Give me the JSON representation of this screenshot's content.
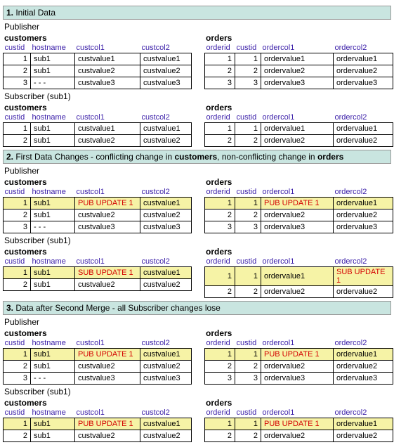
{
  "sections": [
    {
      "num": "1.",
      "title_plain": " Initial Data",
      "title_bold_parts": [],
      "blocks": [
        {
          "role": "Publisher",
          "customers": {
            "title": "customers",
            "headers": [
              "custid",
              "hostname",
              "custcol1",
              "custcol2"
            ],
            "rows": [
              {
                "cells": [
                  "1",
                  "sub1",
                  "custvalue1",
                  "custvalue1"
                ],
                "hl": false,
                "upd": []
              },
              {
                "cells": [
                  "2",
                  "sub1",
                  "custvalue2",
                  "custvalue2"
                ],
                "hl": false,
                "upd": []
              },
              {
                "cells": [
                  "3",
                  "- - -",
                  "custvalue3",
                  "custvalue3"
                ],
                "hl": false,
                "upd": []
              }
            ]
          },
          "orders": {
            "title": "orders",
            "headers": [
              "orderid",
              "custid",
              "ordercol1",
              "ordercol2"
            ],
            "rows": [
              {
                "cells": [
                  "1",
                  "1",
                  "ordervalue1",
                  "ordervalue1"
                ],
                "hl": false,
                "upd": []
              },
              {
                "cells": [
                  "2",
                  "2",
                  "ordervalue2",
                  "ordervalue2"
                ],
                "hl": false,
                "upd": []
              },
              {
                "cells": [
                  "3",
                  "3",
                  "ordervalue3",
                  "ordervalue3"
                ],
                "hl": false,
                "upd": []
              }
            ]
          }
        },
        {
          "role": "Subscriber (sub1)",
          "customers": {
            "title": "customers",
            "headers": [
              "custid",
              "hostname",
              "custcol1",
              "custcol2"
            ],
            "rows": [
              {
                "cells": [
                  "1",
                  "sub1",
                  "custvalue1",
                  "custvalue1"
                ],
                "hl": false,
                "upd": []
              },
              {
                "cells": [
                  "2",
                  "sub1",
                  "custvalue2",
                  "custvalue2"
                ],
                "hl": false,
                "upd": []
              }
            ]
          },
          "orders": {
            "title": "orders",
            "headers": [
              "orderid",
              "custid",
              "ordercol1",
              "ordercol2"
            ],
            "rows": [
              {
                "cells": [
                  "1",
                  "1",
                  "ordervalue1",
                  "ordervalue1"
                ],
                "hl": false,
                "upd": []
              },
              {
                "cells": [
                  "2",
                  "2",
                  "ordervalue2",
                  "ordervalue2"
                ],
                "hl": false,
                "upd": []
              }
            ]
          }
        }
      ]
    },
    {
      "num": "2.",
      "title_plain": " First Data Changes - conflicting change in ",
      "title_bold_parts": [
        "customers",
        ", non-conflicting change in ",
        "orders"
      ],
      "blocks": [
        {
          "role": "Publisher",
          "customers": {
            "title": "customers",
            "headers": [
              "custid",
              "hostname",
              "custcol1",
              "custcol2"
            ],
            "rows": [
              {
                "cells": [
                  "1",
                  "sub1",
                  "PUB UPDATE 1",
                  "custvalue1"
                ],
                "hl": true,
                "upd": [
                  2
                ]
              },
              {
                "cells": [
                  "2",
                  "sub1",
                  "custvalue2",
                  "custvalue2"
                ],
                "hl": false,
                "upd": []
              },
              {
                "cells": [
                  "3",
                  "- - -",
                  "custvalue3",
                  "custvalue3"
                ],
                "hl": false,
                "upd": []
              }
            ]
          },
          "orders": {
            "title": "orders",
            "headers": [
              "orderid",
              "custid",
              "ordercol1",
              "ordercol2"
            ],
            "rows": [
              {
                "cells": [
                  "1",
                  "1",
                  "PUB UPDATE 1",
                  "ordervalue1"
                ],
                "hl": true,
                "upd": [
                  2
                ]
              },
              {
                "cells": [
                  "2",
                  "2",
                  "ordervalue2",
                  "ordervalue2"
                ],
                "hl": false,
                "upd": []
              },
              {
                "cells": [
                  "3",
                  "3",
                  "ordervalue3",
                  "ordervalue3"
                ],
                "hl": false,
                "upd": []
              }
            ]
          }
        },
        {
          "role": "Subscriber (sub1)",
          "customers": {
            "title": "customers",
            "headers": [
              "custid",
              "hostname",
              "custcol1",
              "custcol2"
            ],
            "rows": [
              {
                "cells": [
                  "1",
                  "sub1",
                  "SUB UPDATE 1",
                  "custvalue1"
                ],
                "hl": true,
                "upd": [
                  2
                ]
              },
              {
                "cells": [
                  "2",
                  "sub1",
                  "custvalue2",
                  "custvalue2"
                ],
                "hl": false,
                "upd": []
              }
            ]
          },
          "orders": {
            "title": "orders",
            "headers": [
              "orderid",
              "custid",
              "ordercol1",
              "ordercol2"
            ],
            "rows": [
              {
                "cells": [
                  "1",
                  "1",
                  "ordervalue1",
                  "SUB UPDATE 1"
                ],
                "hl": true,
                "upd": [
                  3
                ]
              },
              {
                "cells": [
                  "2",
                  "2",
                  "ordervalue2",
                  "ordervalue2"
                ],
                "hl": false,
                "upd": []
              }
            ]
          }
        }
      ]
    },
    {
      "num": "3.",
      "title_plain": " Data after Second Merge - all Subscriber changes lose",
      "title_bold_parts": [],
      "blocks": [
        {
          "role": "Publisher",
          "customers": {
            "title": "customers",
            "headers": [
              "custid",
              "hostname",
              "custcol1",
              "custcol2"
            ],
            "rows": [
              {
                "cells": [
                  "1",
                  "sub1",
                  "PUB UPDATE 1",
                  "custvalue1"
                ],
                "hl": true,
                "upd": [
                  2
                ]
              },
              {
                "cells": [
                  "2",
                  "sub1",
                  "custvalue2",
                  "custvalue2"
                ],
                "hl": false,
                "upd": []
              },
              {
                "cells": [
                  "3",
                  "- - -",
                  "custvalue3",
                  "custvalue3"
                ],
                "hl": false,
                "upd": []
              }
            ]
          },
          "orders": {
            "title": "orders",
            "headers": [
              "orderid",
              "custid",
              "ordercol1",
              "ordercol2"
            ],
            "rows": [
              {
                "cells": [
                  "1",
                  "1",
                  "PUB UPDATE 1",
                  "ordervalue1"
                ],
                "hl": true,
                "upd": [
                  2
                ]
              },
              {
                "cells": [
                  "2",
                  "2",
                  "ordervalue2",
                  "ordervalue2"
                ],
                "hl": false,
                "upd": []
              },
              {
                "cells": [
                  "3",
                  "3",
                  "ordervalue3",
                  "ordervalue3"
                ],
                "hl": false,
                "upd": []
              }
            ]
          }
        },
        {
          "role": "Subscriber (sub1)",
          "customers": {
            "title": "customers",
            "headers": [
              "custid",
              "hostname",
              "custcol1",
              "custcol2"
            ],
            "rows": [
              {
                "cells": [
                  "1",
                  "sub1",
                  "PUB UPDATE 1",
                  "custvalue1"
                ],
                "hl": true,
                "upd": [
                  2
                ]
              },
              {
                "cells": [
                  "2",
                  "sub1",
                  "custvalue2",
                  "custvalue2"
                ],
                "hl": false,
                "upd": []
              }
            ]
          },
          "orders": {
            "title": "orders",
            "headers": [
              "orderid",
              "custid",
              "ordercol1",
              "ordercol2"
            ],
            "rows": [
              {
                "cells": [
                  "1",
                  "1",
                  "PUB UPDATE 1",
                  "ordervalue1"
                ],
                "hl": true,
                "upd": [
                  2
                ]
              },
              {
                "cells": [
                  "2",
                  "2",
                  "ordervalue2",
                  "ordervalue2"
                ],
                "hl": false,
                "upd": []
              }
            ]
          }
        }
      ]
    }
  ]
}
